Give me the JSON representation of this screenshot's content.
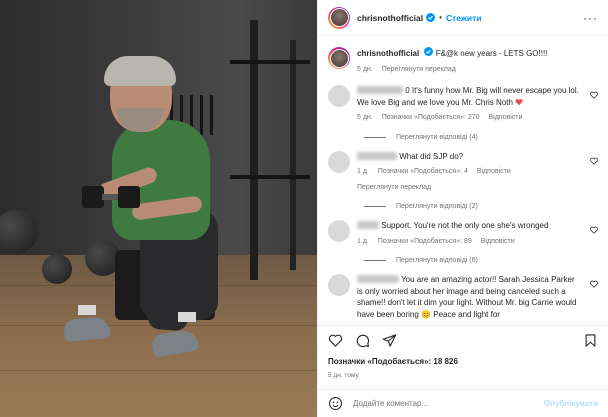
{
  "header": {
    "username": "chrisnothofficial",
    "separator": "•",
    "follow_label": "Стежити",
    "more_label": "···"
  },
  "caption": {
    "username": "chrisnothofficial",
    "text": "F&@k new years - LETS GO!!!!",
    "time": "5 дн.",
    "translate": "Переглянути переклад"
  },
  "comments": [
    {
      "text": "0 It's funny how Mr. Big will never escape you lol. We love Big and we love you Mr. Chris Noth",
      "time": "5 дн.",
      "likes": "Позначки «Подобається»: 270",
      "reply": "Відповісти",
      "view_replies": "Переглянути відповіді (4)"
    },
    {
      "text": "What did SJP do?",
      "time": "1 д.",
      "likes": "Позначки «Подобається»: 4",
      "reply": "Відповісти",
      "translate": "Переглянути переклад",
      "view_replies": "Переглянути відповіді (2)"
    },
    {
      "text": "Support. You're not the only one she's wronged",
      "time": "1 д.",
      "likes": "Позначки «Подобається»: 89",
      "reply": "Відповісти",
      "view_replies": "Переглянути відповіді (6)"
    },
    {
      "text": "You are an amazing actor!! Sarah Jessica Parker is only worried about her image and being canceled such a shame!! don't let it dim your light. Without Mr. big Carrie would have been boring 😊 Peace and light for"
    }
  ],
  "footer": {
    "likes": "Позначки «Подобається»: 18 826",
    "time": "5 дн. тому",
    "comment_placeholder": "Додайте коментар...",
    "publish_label": "Опублікувати"
  },
  "colors": {
    "accent": "#0095f6",
    "publish_disabled": "#b2dffc",
    "shirt": "#3f7a40",
    "heart": "#ed4956"
  },
  "icons": [
    "verified-icon",
    "more-icon",
    "heart-icon",
    "comment-icon",
    "share-icon",
    "bookmark-icon",
    "emoji-icon"
  ]
}
